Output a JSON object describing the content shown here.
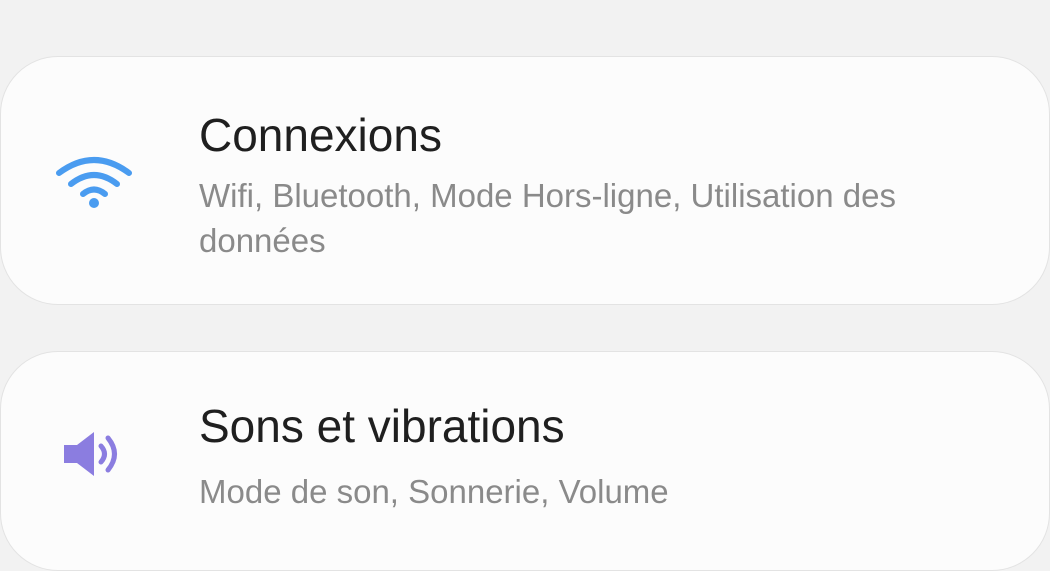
{
  "settings": {
    "items": [
      {
        "title": "Connexions",
        "subtitle": "Wifi, Bluetooth, Mode Hors-ligne, Utilisation des données",
        "icon": "wifi-icon",
        "icon_color": "#4a9cf0"
      },
      {
        "title": "Sons et vibrations",
        "subtitle": "Mode de son, Sonnerie, Volume",
        "icon": "speaker-icon",
        "icon_color": "#8b7de0"
      }
    ]
  }
}
